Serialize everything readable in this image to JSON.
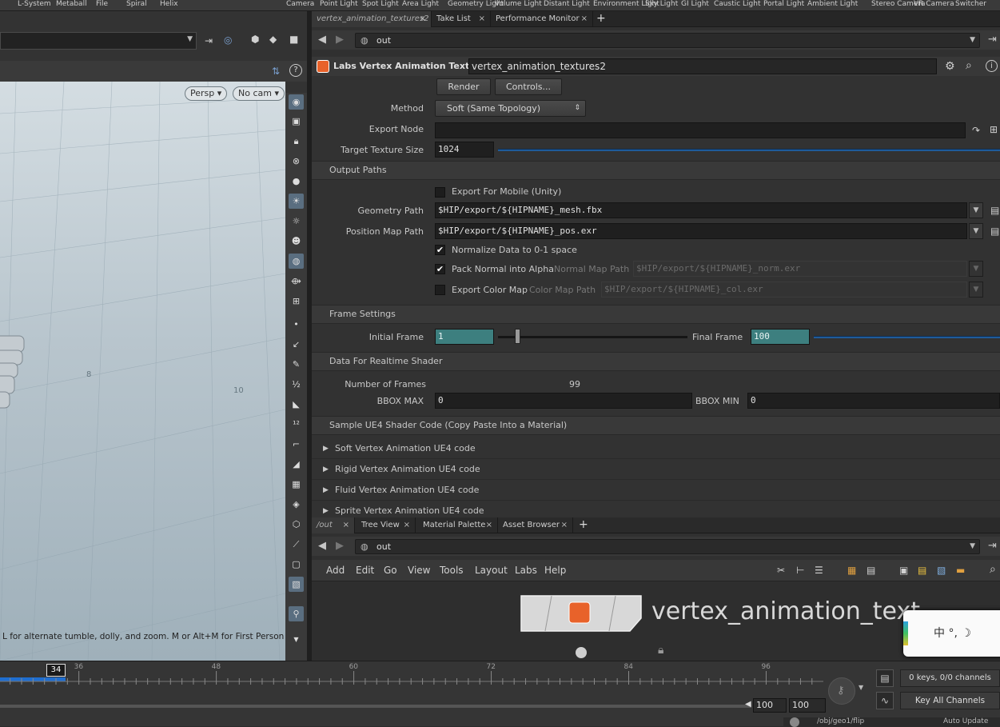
{
  "shelf": {
    "items": [
      "L-System",
      "Metaball",
      "File",
      "Spiral",
      "Helix",
      "Camera",
      "Point Light",
      "Spot Light",
      "Area Light",
      "Geometry Light",
      "Volume Light",
      "Distant Light",
      "Environment Light",
      "Sky Light",
      "GI Light",
      "Caustic Light",
      "Portal Light",
      "Ambient Light",
      "Stereo Camera",
      "VR Camera",
      "Switcher"
    ]
  },
  "viewport": {
    "persp_label": "Persp",
    "camera_label": "No cam",
    "hint": "L for alternate tumble, dolly, and zoom.   M or Alt+M for First Person",
    "grid_labels": [
      "8",
      "10"
    ]
  },
  "params_pane": {
    "tabs": [
      {
        "label": "vertex_animation_textures2",
        "close": "×"
      },
      {
        "label": "Take List",
        "close": "×"
      },
      {
        "label": "Performance Monitor",
        "close": "×"
      }
    ],
    "add_tab": "+",
    "path": "out",
    "node_type": "Labs Vertex Animation Textures",
    "node_name": "vertex_animation_textures2",
    "render_button": "Render",
    "controls_button": "Controls...",
    "method_label": "Method",
    "method_value": "Soft (Same Topology)",
    "export_node_label": "Export Node",
    "export_node_value": "",
    "target_size_label": "Target Texture Size",
    "target_size_value": "1024",
    "output_paths_section": "Output Paths",
    "export_mobile_label": "Export For Mobile (Unity)",
    "geometry_path_label": "Geometry Path",
    "geometry_path_value": "$HIP/export/${HIPNAME}_mesh.fbx",
    "position_map_label": "Position Map Path",
    "position_map_value": "$HIP/export/${HIPNAME}_pos.exr",
    "normalize_label": "Normalize Data to 0-1 space",
    "pack_normal_label": "Pack Normal into Alpha",
    "normal_map_label": "Normal Map Path",
    "normal_map_value": "$HIP/export/${HIPNAME}_norm.exr",
    "export_color_label": "Export Color Map",
    "color_map_label": "Color Map Path",
    "color_map_value": "$HIP/export/${HIPNAME}_col.exr",
    "frame_section": "Frame Settings",
    "initial_frame_label": "Initial Frame",
    "initial_frame_value": "1",
    "final_frame_label": "Final Frame",
    "final_frame_value": "100",
    "realtime_section": "Data For Realtime Shader",
    "num_frames_label": "Number of Frames",
    "num_frames_value": "99",
    "bbox_max_label": "BBOX MAX",
    "bbox_max_value": "0",
    "bbox_min_label": "BBOX MIN",
    "bbox_min_value": "0",
    "ue4_section": "Sample UE4 Shader Code (Copy Paste Into a Material)",
    "folders": [
      "Soft Vertex Animation UE4 code",
      "Rigid Vertex Animation UE4 code",
      "Fluid Vertex Animation UE4 code",
      "Sprite Vertex Animation UE4 code"
    ]
  },
  "network_pane": {
    "tabs": [
      {
        "label": "/out",
        "close": "×"
      },
      {
        "label": "Tree View",
        "close": "×"
      },
      {
        "label": "Material Palette",
        "close": "×"
      },
      {
        "label": "Asset Browser",
        "close": "×"
      }
    ],
    "add_tab": "+",
    "path": "out",
    "menu": [
      "Add",
      "Edit",
      "Go",
      "View",
      "Tools",
      "Layout",
      "Labs",
      "Help"
    ],
    "node_label": "vertex_animation_text",
    "ime_text": "中 °, ☽"
  },
  "timeline": {
    "current_frame": "34",
    "ticks": [
      "36",
      "48",
      "60",
      "72",
      "84",
      "96"
    ],
    "range_end_a": "100",
    "range_end_b": "100",
    "keys_status": "0 keys, 0/0 channels",
    "key_all_button": "Key All Channels",
    "status_path": "/obj/geo1/flip",
    "auto_update": "Auto Update"
  },
  "colors": {
    "accent_blue": "#1f5b9a",
    "teal_field": "#3d7f7f",
    "node_icon": "#e8622a"
  }
}
